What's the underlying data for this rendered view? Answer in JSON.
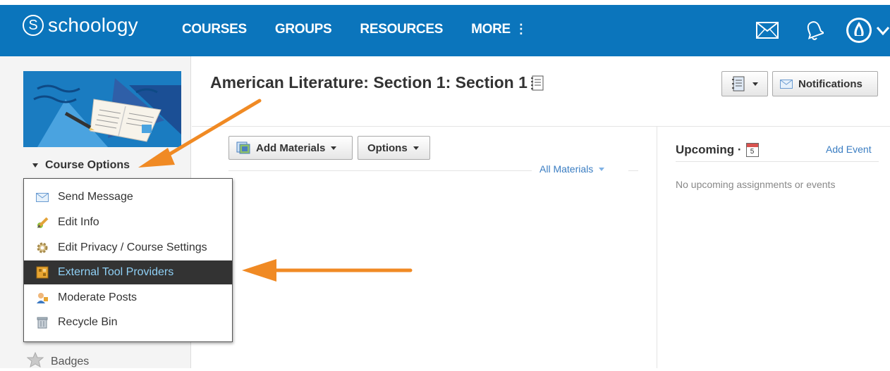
{
  "header": {
    "logo_letter": "S",
    "logo_text": "schoology",
    "nav": [
      {
        "label": "COURSES"
      },
      {
        "label": "GROUPS"
      },
      {
        "label": "RESOURCES"
      },
      {
        "label": "MORE"
      }
    ],
    "more_dots": "⋮",
    "icons": [
      "mail-icon",
      "bell-icon",
      "avatar",
      "chevron-down-icon"
    ]
  },
  "sidebar": {
    "course_options_label": "Course Options",
    "menu": [
      {
        "label": "Send Message",
        "icon": "envelope-icon"
      },
      {
        "label": "Edit Info",
        "icon": "pencil-icon"
      },
      {
        "label": "Edit Privacy / Course Settings",
        "icon": "gear-icon"
      },
      {
        "label": "External Tool Providers",
        "icon": "puzzle-icon",
        "selected": true
      },
      {
        "label": "Moderate Posts",
        "icon": "moderator-icon"
      },
      {
        "label": "Recycle Bin",
        "icon": "recycle-bin-icon"
      }
    ],
    "badges_label": "Badges"
  },
  "main": {
    "title": "American Literature: Section 1: Section 1",
    "add_materials_label": "Add Materials",
    "options_label": "Options",
    "all_materials_label": "All Materials",
    "notifications_label": "Notifications"
  },
  "upcoming": {
    "title": "Upcoming ·",
    "calendar_day": "5",
    "add_event_label": "Add Event",
    "empty_text": "No upcoming assignments or events"
  },
  "colors": {
    "header_bg": "#0b75bc",
    "highlight_bg": "#333333",
    "highlight_text": "#8fd0f5",
    "arrow": "#f08a24",
    "link": "#3a7dc2"
  }
}
